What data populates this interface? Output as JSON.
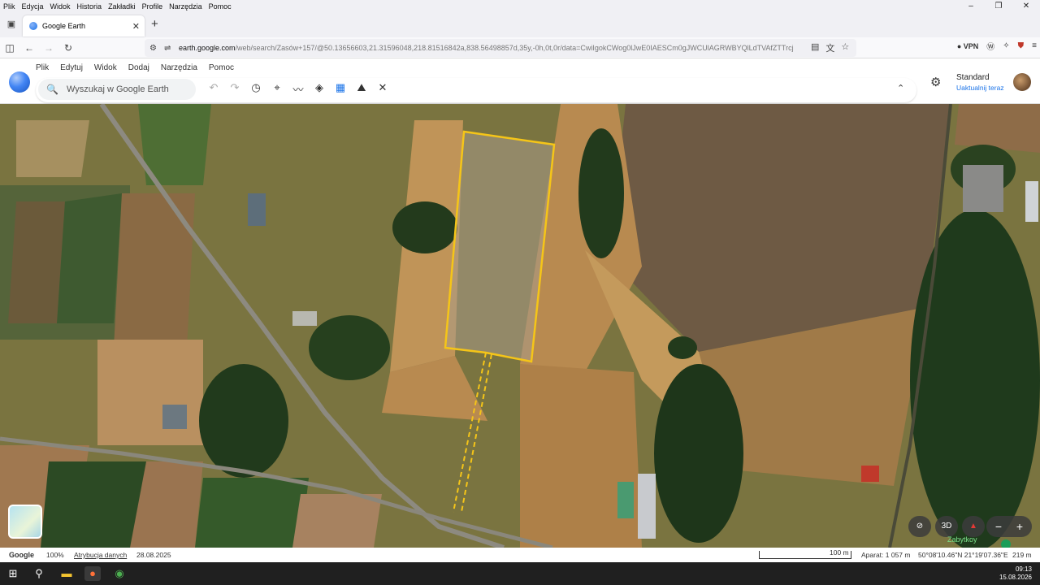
{
  "os_menu": {
    "items": [
      "Plik",
      "Edycja",
      "Widok",
      "Historia",
      "Zakładki",
      "Profile",
      "Narzędzia",
      "Pomoc"
    ]
  },
  "window_controls": {
    "minimize": "–",
    "maximize": "❐",
    "close": "✕"
  },
  "browser": {
    "tab_title": "Google Earth",
    "tab_close": "✕",
    "new_tab": "+",
    "url_host": "earth.google.com",
    "url_path": "/web/search/Zasów+157/@50.13656603,21.31596048,218.81516842a,838.56498857d,35y,-0h,0t,0r/data=CwiIgokCWog0lJwE0IAESCm0gJWCUlAGRWBYQlLdTVAfZTTrcj",
    "vpn_label": "VPN"
  },
  "earth_menu": {
    "items": [
      "Plik",
      "Edytuj",
      "Widok",
      "Dodaj",
      "Narzędzia",
      "Pomoc"
    ]
  },
  "search": {
    "placeholder": "Wyszukaj w Google Earth"
  },
  "toolbar": {
    "icons": [
      "undo-icon",
      "redo-icon",
      "history-icon",
      "placemark-icon",
      "path-icon",
      "layers-icon",
      "ruler-icon",
      "gallery-icon",
      "satellite-icon"
    ]
  },
  "account": {
    "map_style": "Standard",
    "update_label": "Uaktualnij teraz"
  },
  "map": {
    "accent_boundary": "#f5c518",
    "place_label": "Zabytkoy",
    "controls": {
      "three_d": "3D",
      "zoom_out": "−",
      "zoom_in": "+"
    }
  },
  "status": {
    "brand": "Google",
    "zoom": "100%",
    "attribution": "Atrybucja danych",
    "imagery_date": "28.08.2025",
    "scale_label": "100 m",
    "camera": "Aparat: 1 057 m",
    "coords": "50°08'10.46\"N 21°19'07.36\"E",
    "elevation": "219 m"
  },
  "taskbar": {
    "time": "09:13",
    "date": "15.08.2026"
  }
}
